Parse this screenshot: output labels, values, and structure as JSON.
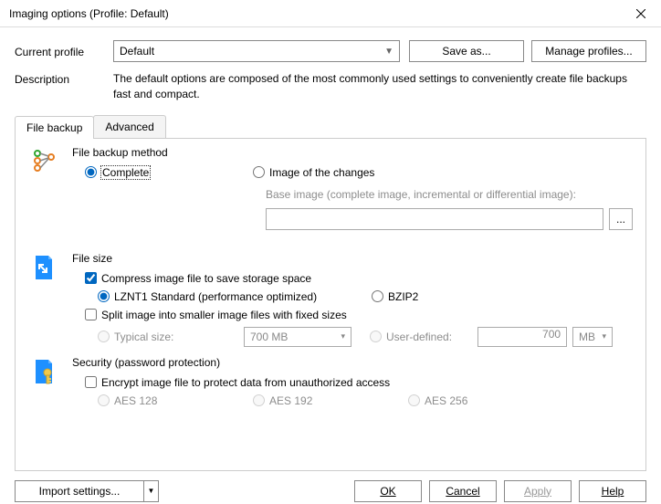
{
  "window": {
    "title": "Imaging options (Profile: Default)"
  },
  "profile": {
    "label": "Current profile",
    "value": "Default",
    "save_as": "Save as...",
    "manage": "Manage profiles..."
  },
  "description": {
    "label": "Description",
    "text": "The default options are composed of the most commonly used settings to conveniently create file backups fast and compact."
  },
  "tabs": {
    "file_backup": "File backup",
    "advanced": "Advanced"
  },
  "method": {
    "title": "File backup method",
    "complete": "Complete",
    "changes": "Image of the changes",
    "base_hint": "Base image (complete image, incremental or differential image):",
    "browse": "..."
  },
  "size": {
    "title": "File size",
    "compress": "Compress image file to save storage space",
    "lznt1": "LZNT1 Standard (performance optimized)",
    "bzip2": "BZIP2",
    "split": "Split image into smaller image files with fixed sizes",
    "typical": "Typical size:",
    "typical_value": "700 MB",
    "user_defined": "User-defined:",
    "ud_value": "700",
    "ud_unit": "MB"
  },
  "security": {
    "title": "Security (password protection)",
    "encrypt": "Encrypt image file to protect data from unauthorized access",
    "aes128": "AES 128",
    "aes192": "AES 192",
    "aes256": "AES 256"
  },
  "footer": {
    "import": "Import settings...",
    "ok": "OK",
    "cancel": "Cancel",
    "apply": "Apply",
    "help": "Help"
  }
}
